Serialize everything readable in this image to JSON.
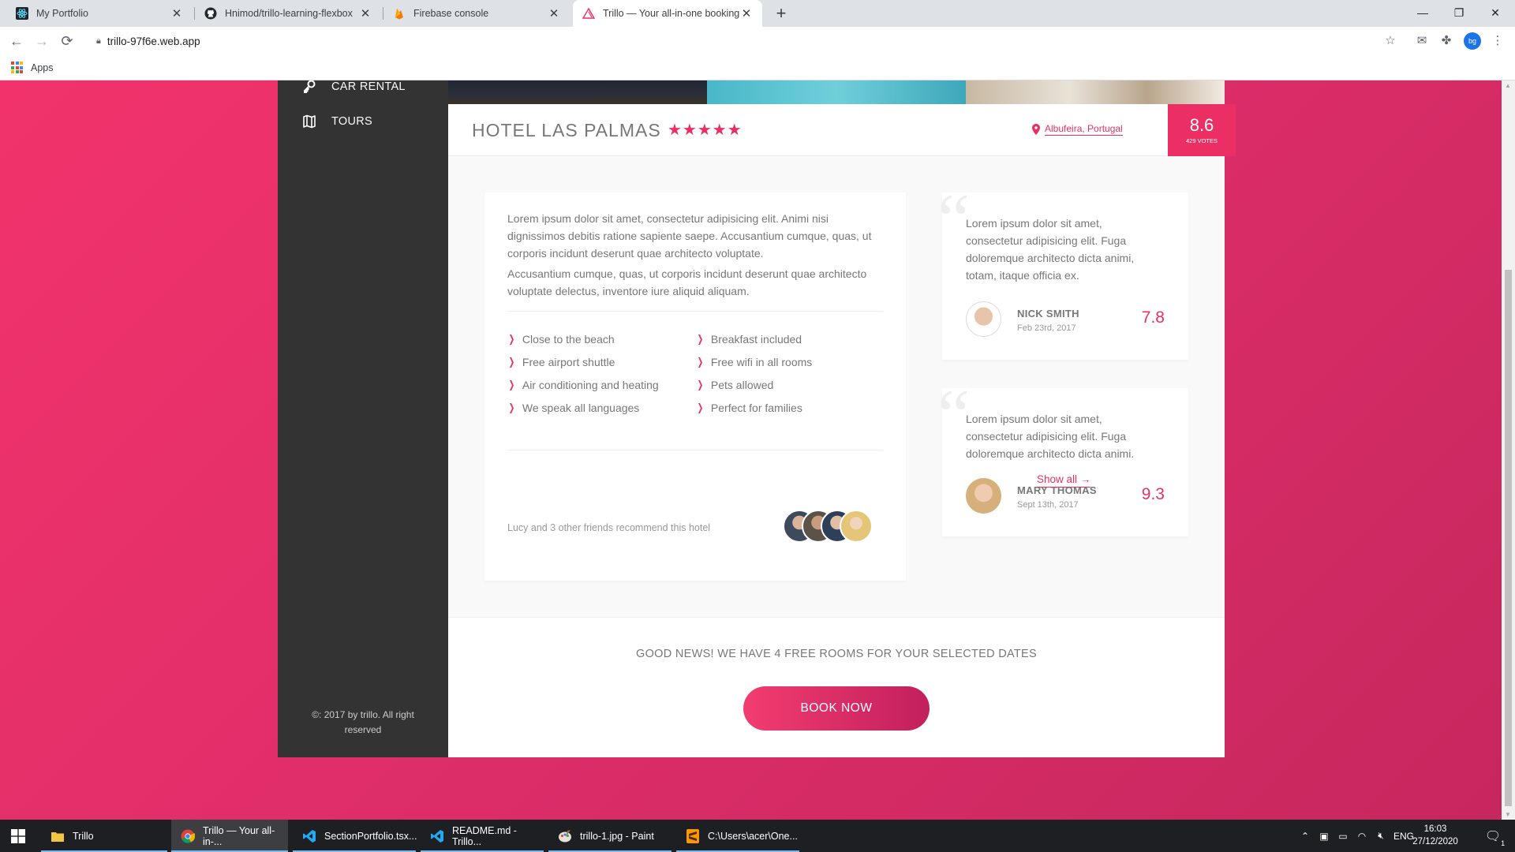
{
  "browser": {
    "tabs": [
      {
        "title": "My Portfolio"
      },
      {
        "title": "Hnimod/trillo-learning-flexbox"
      },
      {
        "title": "Firebase console"
      },
      {
        "title": "Trillo — Your all-in-one booking"
      }
    ],
    "url": "trillo-97f6e.web.app",
    "bookmarks": {
      "apps_label": "Apps"
    },
    "profile_initials": "bg"
  },
  "sidebar": {
    "items": [
      {
        "label": "Car rental",
        "icon": "key-icon"
      },
      {
        "label": "Tours",
        "icon": "map-icon"
      }
    ],
    "legal": "©: 2017 by trillo. All right reserved"
  },
  "overview": {
    "hotel_name": "Hotel Las Palmas",
    "stars": "★★★★★",
    "star_count": 5,
    "location": "Albufeira, Portugal",
    "rating_average": "8.6",
    "rating_count": "429 votes"
  },
  "description": {
    "paragraphs": [
      "Lorem ipsum dolor sit amet, consectetur adipisicing elit. Animi nisi dignissimos debitis ratione sapiente saepe. Accusantium cumque, quas, ut corporis incidunt deserunt quae architecto voluptate.",
      "Accusantium cumque, quas, ut corporis incidunt deserunt quae architecto voluptate delectus, inventore iure aliquid aliquam."
    ],
    "features": [
      "Close to the beach",
      "Breakfast included",
      "Free airport shuttle",
      "Free wifi in all rooms",
      "Air conditioning and heating",
      "Pets allowed",
      "We speak all languages",
      "Perfect for families"
    ],
    "recommend": "Lucy and 3 other friends recommend this hotel"
  },
  "reviews": [
    {
      "text": "Lorem ipsum dolor sit amet, consectetur adipisicing elit. Fuga doloremque architecto dicta animi, totam, itaque officia ex.",
      "name": "Nick Smith",
      "date": "Feb 23rd, 2017",
      "rating": "7.8"
    },
    {
      "text": "Lorem ipsum dolor sit amet, consectetur adipisicing elit. Fuga doloremque architecto dicta animi.",
      "name": "Mary Thomas",
      "date": "Sept 13th, 2017",
      "rating": "9.3"
    }
  ],
  "show_all": "Show all →",
  "cta": {
    "text": "Good news! We have 4 free rooms for your selected dates",
    "button": "Book now"
  },
  "colors": {
    "primary": "#eb2f64",
    "sidebar": "#333333",
    "background": "#faf9f9"
  },
  "taskbar": {
    "items": [
      {
        "label": "Trillo"
      },
      {
        "label": "Trillo — Your all-in-..."
      },
      {
        "label": "SectionPortfolio.tsx..."
      },
      {
        "label": "README.md - Trillo..."
      },
      {
        "label": "trillo-1.jpg - Paint"
      },
      {
        "label": "C:\\Users\\acer\\One..."
      }
    ],
    "language": "ENG",
    "time": "16:03",
    "date": "27/12/2020",
    "notification_count": "1"
  }
}
